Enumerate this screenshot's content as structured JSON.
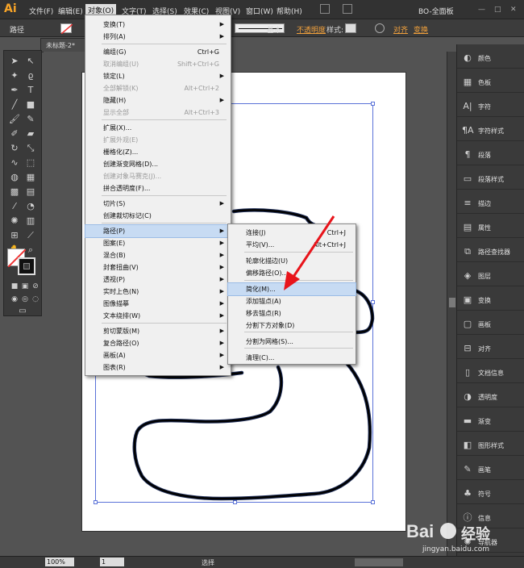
{
  "app": {
    "logo": "Ai"
  },
  "menubar": {
    "items": [
      "文件(F)",
      "编辑(E)",
      "对象(O)",
      "文字(T)",
      "选择(S)",
      "效果(C)",
      "视图(V)",
      "窗口(W)",
      "帮助(H)"
    ],
    "workspace": "BO-全面板"
  },
  "ctrlbar": {
    "label": "路径",
    "stroke_style": "基本",
    "opacity_label": "不透明度",
    "style_label": "样式:",
    "align_label": "对齐",
    "transform_label": "变换"
  },
  "document": {
    "tab": "未标题-2*"
  },
  "object_menu": {
    "items": [
      {
        "label": "变换(T)",
        "shortcut": "",
        "sub": true,
        "disabled": false
      },
      {
        "label": "排列(A)",
        "shortcut": "",
        "sub": true,
        "disabled": false
      },
      {
        "label": "编组(G)",
        "shortcut": "Ctrl+G",
        "sub": false,
        "disabled": false
      },
      {
        "label": "取消编组(U)",
        "shortcut": "Shift+Ctrl+G",
        "sub": false,
        "disabled": true
      },
      {
        "label": "锁定(L)",
        "shortcut": "",
        "sub": true,
        "disabled": false
      },
      {
        "label": "全部解锁(K)",
        "shortcut": "Alt+Ctrl+2",
        "sub": false,
        "disabled": true
      },
      {
        "label": "隐藏(H)",
        "shortcut": "",
        "sub": true,
        "disabled": false
      },
      {
        "label": "显示全部",
        "shortcut": "Alt+Ctrl+3",
        "sub": false,
        "disabled": true
      },
      {
        "label": "扩展(X)...",
        "shortcut": "",
        "sub": false,
        "disabled": false
      },
      {
        "label": "扩展外观(E)",
        "shortcut": "",
        "sub": false,
        "disabled": true
      },
      {
        "label": "栅格化(Z)...",
        "shortcut": "",
        "sub": false,
        "disabled": false
      },
      {
        "label": "创建渐变网格(D)...",
        "shortcut": "",
        "sub": false,
        "disabled": false
      },
      {
        "label": "创建对象马赛克(J)...",
        "shortcut": "",
        "sub": false,
        "disabled": true
      },
      {
        "label": "拼合透明度(F)...",
        "shortcut": "",
        "sub": false,
        "disabled": false
      },
      {
        "label": "切片(S)",
        "shortcut": "",
        "sub": true,
        "disabled": false
      },
      {
        "label": "创建裁切标记(C)",
        "shortcut": "",
        "sub": false,
        "disabled": false
      },
      {
        "label": "路径(P)",
        "shortcut": "",
        "sub": true,
        "disabled": false
      },
      {
        "label": "图案(E)",
        "shortcut": "",
        "sub": true,
        "disabled": false
      },
      {
        "label": "混合(B)",
        "shortcut": "",
        "sub": true,
        "disabled": false
      },
      {
        "label": "封套扭曲(V)",
        "shortcut": "",
        "sub": true,
        "disabled": false
      },
      {
        "label": "透视(P)",
        "shortcut": "",
        "sub": true,
        "disabled": false
      },
      {
        "label": "实时上色(N)",
        "shortcut": "",
        "sub": true,
        "disabled": false
      },
      {
        "label": "图像描摹",
        "shortcut": "",
        "sub": true,
        "disabled": false
      },
      {
        "label": "文本绕排(W)",
        "shortcut": "",
        "sub": true,
        "disabled": false
      },
      {
        "label": "剪切蒙版(M)",
        "shortcut": "",
        "sub": true,
        "disabled": false
      },
      {
        "label": "复合路径(O)",
        "shortcut": "",
        "sub": true,
        "disabled": false
      },
      {
        "label": "画板(A)",
        "shortcut": "",
        "sub": true,
        "disabled": false
      },
      {
        "label": "图表(R)",
        "shortcut": "",
        "sub": true,
        "disabled": false
      }
    ]
  },
  "path_menu": {
    "items": [
      {
        "label": "连接(J)",
        "shortcut": "Ctrl+J"
      },
      {
        "label": "平均(V)...",
        "shortcut": "Alt+Ctrl+J"
      },
      {
        "label": "轮廓化描边(U)",
        "shortcut": ""
      },
      {
        "label": "偏移路径(O)...",
        "shortcut": ""
      },
      {
        "label": "简化(M)...",
        "shortcut": ""
      },
      {
        "label": "添加锚点(A)",
        "shortcut": ""
      },
      {
        "label": "移去锚点(R)",
        "shortcut": ""
      },
      {
        "label": "分割下方对象(D)",
        "shortcut": ""
      },
      {
        "label": "分割为网格(S)...",
        "shortcut": ""
      },
      {
        "label": "清理(C)...",
        "shortcut": ""
      }
    ]
  },
  "panels": {
    "items": [
      {
        "label": "颜色",
        "icon": "color-icon"
      },
      {
        "label": "色板",
        "icon": "swatches-icon"
      },
      {
        "label": "字符",
        "icon": "character-icon"
      },
      {
        "label": "字符样式",
        "icon": "character-style-icon"
      },
      {
        "label": "段落",
        "icon": "paragraph-icon"
      },
      {
        "label": "段落样式",
        "icon": "paragraph-style-icon"
      },
      {
        "label": "描边",
        "icon": "stroke-icon"
      },
      {
        "label": "属性",
        "icon": "attributes-icon"
      },
      {
        "label": "路径查找器",
        "icon": "pathfinder-icon"
      },
      {
        "label": "图层",
        "icon": "layers-icon"
      },
      {
        "label": "变换",
        "icon": "transform-icon"
      },
      {
        "label": "画板",
        "icon": "artboards-icon"
      },
      {
        "label": "对齐",
        "icon": "align-icon"
      },
      {
        "label": "文档信息",
        "icon": "doc-info-icon"
      },
      {
        "label": "透明度",
        "icon": "transparency-icon"
      },
      {
        "label": "渐变",
        "icon": "gradient-icon"
      },
      {
        "label": "图形样式",
        "icon": "graphic-styles-icon"
      },
      {
        "label": "画笔",
        "icon": "brushes-icon"
      },
      {
        "label": "符号",
        "icon": "symbols-icon"
      },
      {
        "label": "信息",
        "icon": "info-icon"
      },
      {
        "label": "导航器",
        "icon": "navigator-icon"
      }
    ]
  },
  "status": {
    "zoom": "100%",
    "artboard": "1",
    "mode": "选择"
  },
  "watermark": {
    "brand": "Bai",
    "brand2": "经验",
    "url": "jingyan.baidu.com"
  }
}
